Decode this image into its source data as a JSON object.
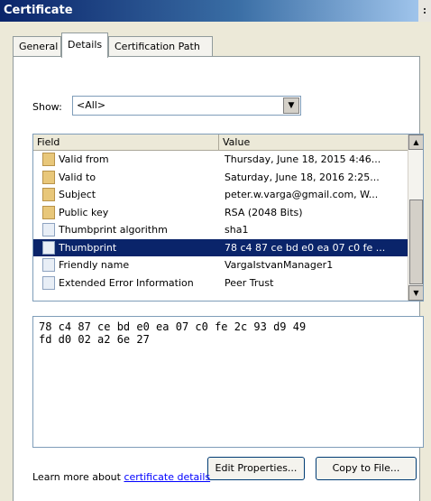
{
  "window": {
    "title": "Certificate"
  },
  "tabs": [
    {
      "label": "General"
    },
    {
      "label": "Details"
    },
    {
      "label": "Certification Path"
    }
  ],
  "show": {
    "label": "Show:",
    "selected": "<All>"
  },
  "list": {
    "columns": [
      "Field",
      "Value"
    ],
    "rows": [
      {
        "field": "Valid from",
        "value": "Thursday, June 18, 2015 4:46...",
        "icon": "cert-field-icon"
      },
      {
        "field": "Valid to",
        "value": "Saturday, June 18, 2016 2:25...",
        "icon": "cert-field-icon"
      },
      {
        "field": "Subject",
        "value": "peter.w.varga@gmail.com, W...",
        "icon": "cert-field-icon"
      },
      {
        "field": "Public key",
        "value": "RSA (2048 Bits)",
        "icon": "cert-field-icon"
      },
      {
        "field": "Thumbprint algorithm",
        "value": "sha1",
        "icon": "property-icon"
      },
      {
        "field": "Thumbprint",
        "value": "78 c4 87 ce bd e0 ea 07 c0 fe ...",
        "icon": "property-icon"
      },
      {
        "field": "Friendly name",
        "value": "VargaIstvanManager1",
        "icon": "property-icon"
      },
      {
        "field": "Extended Error Information",
        "value": "Peer Trust",
        "icon": "property-icon"
      }
    ],
    "selected_row": 5
  },
  "detail_value": "78 c4 87 ce bd e0 ea 07 c0 fe 2c 93 d9 49\nfd d0 02 a2 6e 27",
  "buttons": {
    "edit_properties": "Edit Properties...",
    "copy_to_file": "Copy to File..."
  },
  "footer": {
    "learn_text": "Learn more about ",
    "learn_link": "certificate details"
  }
}
